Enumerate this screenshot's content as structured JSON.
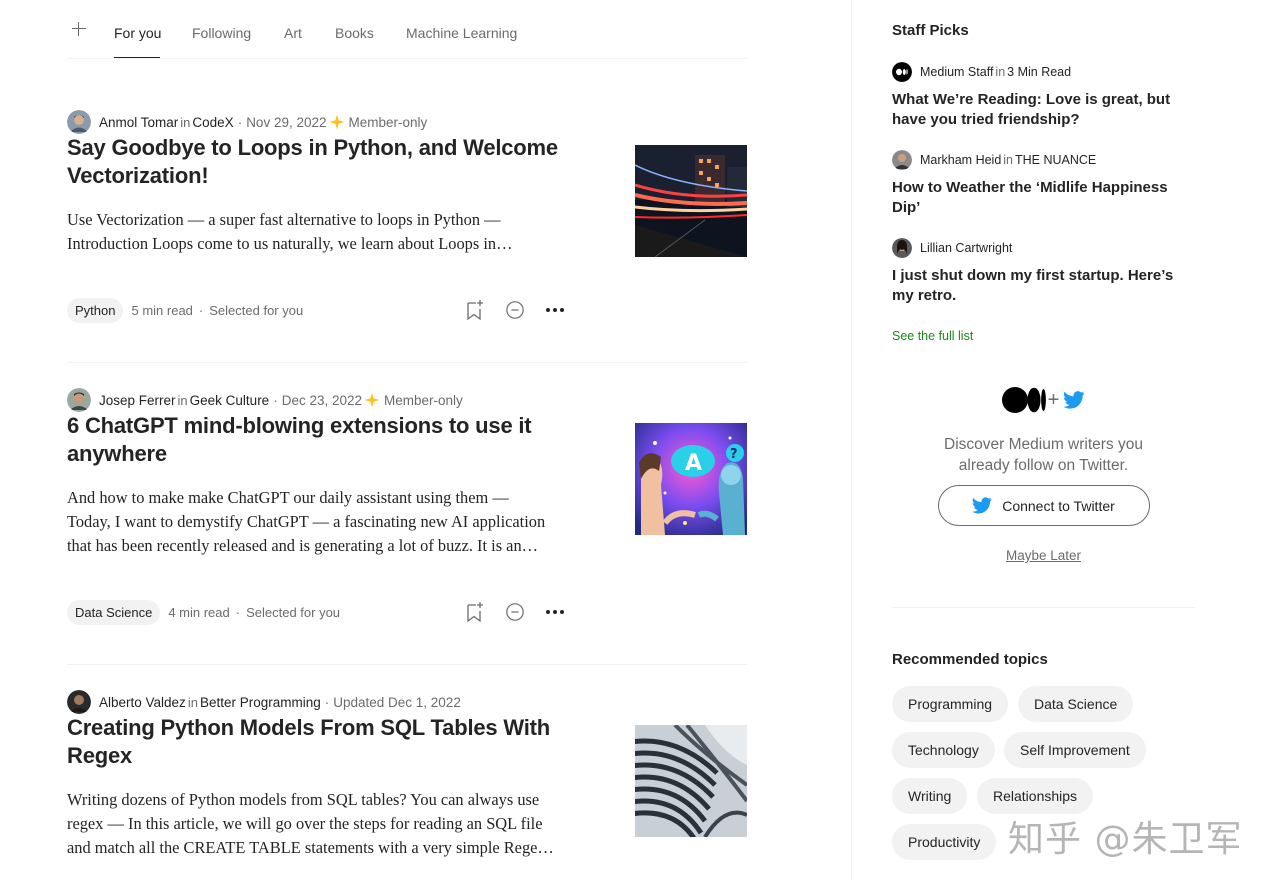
{
  "tabs": {
    "add_label": "+",
    "items": [
      {
        "label": "For you",
        "active": true
      },
      {
        "label": "Following",
        "active": false
      },
      {
        "label": "Art",
        "active": false
      },
      {
        "label": "Books",
        "active": false
      },
      {
        "label": "Machine Learning",
        "active": false
      }
    ]
  },
  "posts": [
    {
      "author": "Anmol Tomar",
      "in": "in",
      "publication": "CodeX",
      "date": "Nov 29, 2022",
      "member_label": "Member-only",
      "title": "Say Goodbye to Loops in Python, and Welcome Vectorization!",
      "subtitle_lines": [
        "Use Vectorization — a super fast alternative to loops in Python —",
        "Introduction Loops come to us naturally, we learn about Loops in…"
      ],
      "tag": "Python",
      "read_time": "5 min read",
      "reason": "Selected for you",
      "thumbnail": "city-light-trails"
    },
    {
      "author": "Josep Ferrer",
      "in": "in",
      "publication": "Geek Culture",
      "date": "Dec 23, 2022",
      "member_label": "Member-only",
      "title": "6 ChatGPT mind-blowing extensions to use it anywhere",
      "subtitle_lines": [
        "And how to make make ChatGPT our daily assistant using them —",
        "Today, I want to demystify ChatGPT — a fascinating new AI application",
        "that has been recently released and is generating a lot of buzz. It is an…"
      ],
      "tag": "Data Science",
      "read_time": "4 min read",
      "reason": "Selected for you",
      "thumbnail": "human-robot-ai"
    },
    {
      "author": "Alberto Valdez",
      "in": "in",
      "publication": "Better Programming",
      "date": "Updated Dec 1, 2022",
      "title": "Creating Python Models From SQL Tables With Regex",
      "subtitle_lines": [
        "Writing dozens of Python models from SQL tables? You can always use",
        "regex — In this article, we will go over the steps for reading an SQL file",
        "and match all the CREATE TABLE statements with a very simple Rege…"
      ],
      "thumbnail": "curved-building"
    }
  ],
  "sidebar": {
    "staff_picks_heading": "Staff Picks",
    "picks": [
      {
        "author": "Medium Staff",
        "in": "in",
        "publication": "3 Min Read",
        "title": "What We’re Reading: Love is great, but have you tried friendship?"
      },
      {
        "author": "Markham Heid",
        "in": "in",
        "publication": "THE NUANCE",
        "title": "How to Weather the ‘Midlife Happiness Dip’"
      },
      {
        "author": "Lillian Cartwright",
        "title": "I just shut down my first startup. Here’s my retro."
      }
    ],
    "see_full_list": "See the full list",
    "twitter": {
      "plus": "+",
      "text_line1": "Discover Medium writers you",
      "text_line2": "already follow on Twitter.",
      "connect_label": "Connect to Twitter",
      "maybe_later": "Maybe Later"
    },
    "recommended_heading": "Recommended topics",
    "topics": [
      "Programming",
      "Data Science",
      "Technology",
      "Self Improvement",
      "Writing",
      "Relationships",
      "Productivity"
    ]
  },
  "watermark": "知乎 @朱卫军",
  "colors": {
    "accent_green": "#1a8917",
    "member_star": "#ffc017",
    "twitter_blue": "#1d9bf0",
    "text": "#242424",
    "muted": "#6b6b6b"
  }
}
